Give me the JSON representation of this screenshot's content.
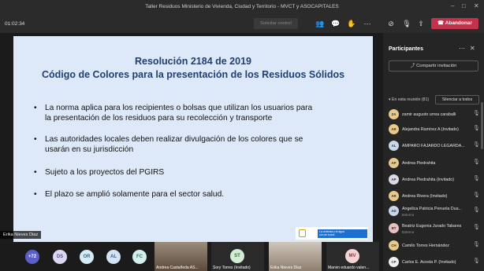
{
  "window": {
    "title": "Taller Residuos Ministerio de Vivienda, Ciudad y Territorio - MVCT y ASOCAPITALES"
  },
  "toolbar": {
    "timer": "01:02:34",
    "request_control": "Solicitar control",
    "leave": "Abandonar"
  },
  "slide": {
    "title_line1": "Resolución 2184 de 2019",
    "title_line2": "Código de Colores para la presentación de los Residuos Sólidos",
    "bullets": [
      {
        "line1": "La norma aplica para los recipientes o bolsas que utilizan los usuarios para",
        "line2": "la presentación de los residuos para su recolección y transporte"
      },
      {
        "line1": "Las autoridades locales deben realizar divulgación de los colores que se",
        "line2": "usarán  en su jurisdicción"
      },
      {
        "line1": "Sujeto a los proyectos del PGIRS",
        "line2": ""
      },
      {
        "line1": "El plazo se amplió solamente para el sector salud.",
        "line2": ""
      }
    ],
    "brand_text": "La vivienda y el agua son de todos"
  },
  "presenter": {
    "name": "Erika Nieves Diaz"
  },
  "filmstrip": {
    "overflow": "+72",
    "avatars": [
      {
        "initials": "DS",
        "bg": "#dcd7f2",
        "fg": "#5b5391"
      },
      {
        "initials": "OR",
        "bg": "#d8ecf5",
        "fg": "#2f6c8a"
      },
      {
        "initials": "AL",
        "bg": "#d4e4f4",
        "fg": "#34608c"
      },
      {
        "initials": "FC",
        "bg": "#d4f0ee",
        "fg": "#2d7a73"
      }
    ],
    "tiles": [
      {
        "name": "Andrea Castañeda AS...",
        "initials": ""
      },
      {
        "name": "Sory Torres (Invitado)",
        "initials": "ST"
      },
      {
        "name": "Erika Nieves Diaz",
        "initials": ""
      },
      {
        "name": "Marvin eduardo valen...",
        "initials": "MV"
      }
    ]
  },
  "panel": {
    "title": "Participantes",
    "share_invite": "Compartir invitación",
    "in_meeting": "En esta reunión (81)",
    "mute_all": "Silenciar a todos",
    "participants": [
      {
        "initials": "ZA",
        "name": "zamir augusto urrea caraballi",
        "sub": "",
        "bg": "#e8c98a"
      },
      {
        "initials": "AR",
        "name": "Alejandra Ramírez A (Invitado)",
        "sub": "",
        "bg": "#e8c98a"
      },
      {
        "initials": "AL",
        "name": "AMPARO FAJARDO LEGARDA...",
        "sub": "",
        "bg": "#c8d8ec"
      },
      {
        "initials": "AP",
        "name": "Andrea Piedrahita",
        "sub": "",
        "bg": "#e8c98a"
      },
      {
        "initials": "AP",
        "name": "Andrea Piedrahita (Invitado)",
        "sub": "",
        "bg": "#d8d8e8"
      },
      {
        "initials": "AR",
        "name": "Andrea Rivera (Invitado)",
        "sub": "",
        "bg": "#e8c98a"
      },
      {
        "initials": "AD",
        "name": "Angelica Patricia Penuela Dua...",
        "sub": "Externo",
        "bg": "#c8d8ec"
      },
      {
        "initials": "BT",
        "name": "Beatriz Eugenia Jurado Tabares",
        "sub": "Externo",
        "bg": "#e8c0c0"
      },
      {
        "initials": "CH",
        "name": "Camilo Torres Hernández",
        "sub": "",
        "bg": "#e8c98a"
      },
      {
        "initials": "CP",
        "name": "Carlos E. Acosta P. (Invitado)",
        "sub": "",
        "bg": "#f0f0f0"
      }
    ]
  }
}
